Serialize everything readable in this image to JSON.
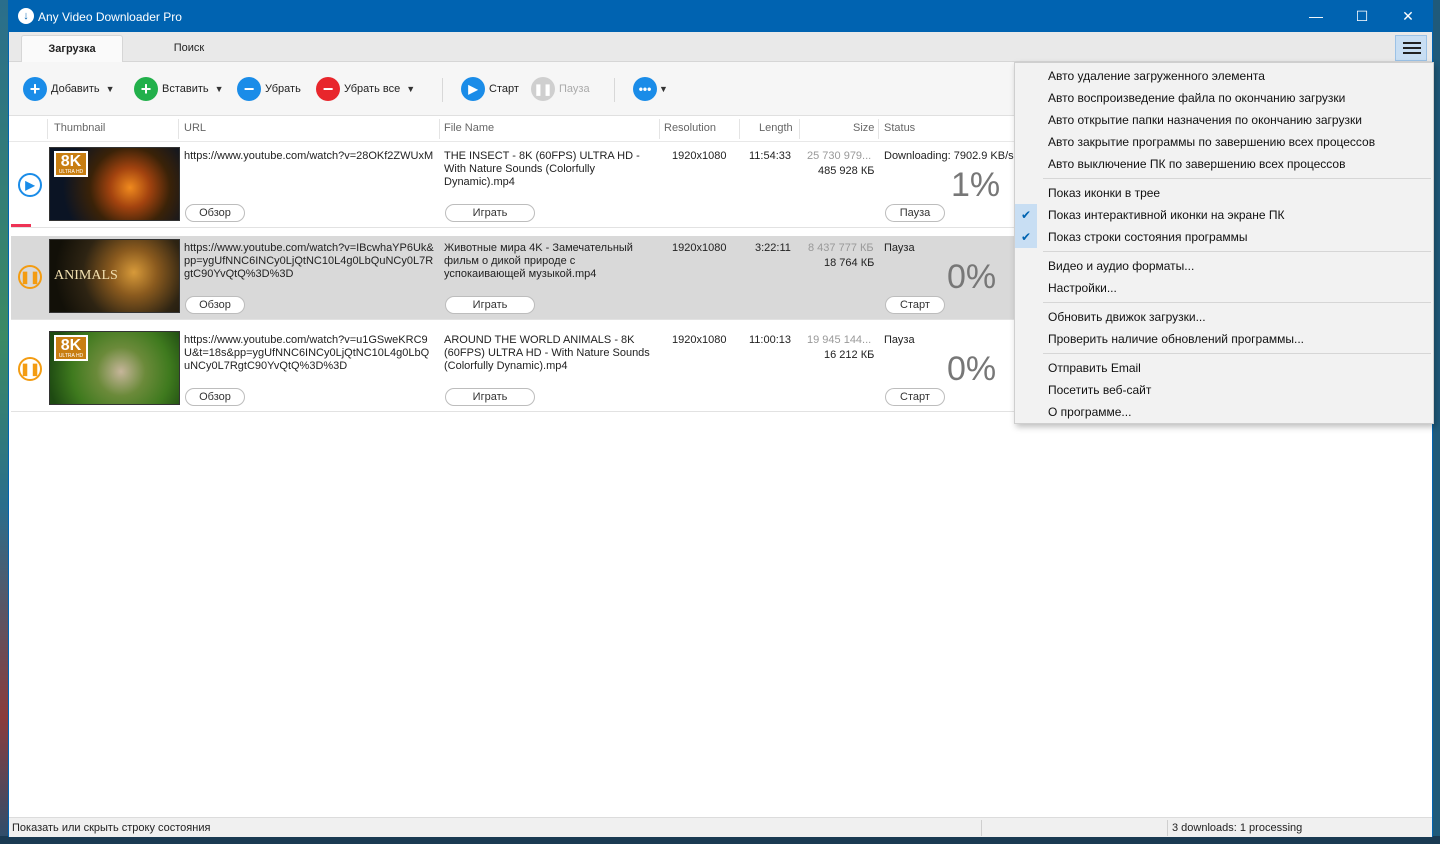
{
  "window": {
    "title": "Any Video Downloader Pro",
    "minimize": "—",
    "maximize": "☐",
    "close": "✕"
  },
  "tabs": [
    {
      "label": "Загрузка"
    },
    {
      "label": "Поиск"
    }
  ],
  "toolbar": {
    "add": "Добавить",
    "paste": "Вставить",
    "remove": "Убрать",
    "remove_all": "Убрать все",
    "start": "Старт",
    "pause": "Пауза"
  },
  "columns": {
    "thumbnail": "Thumbnail",
    "url": "URL",
    "file_name": "File Name",
    "resolution": "Resolution",
    "length": "Length",
    "size": "Size",
    "status": "Status"
  },
  "rows": [
    {
      "url": "https://www.youtube.com/watch?v=28OKf2ZWUxM",
      "file_name": "THE INSECT - 8K (60FPS) ULTRA HD - With Nature Sounds (Colorfully Dynamic).mp4",
      "resolution": "1920x1080",
      "length": "11:54:33",
      "size_total": "25 730 979...",
      "size_done": "485 928 КБ",
      "status": "Downloading: 7902.9 KB/s",
      "percent": "1%",
      "browse": "Обзор",
      "play": "Играть",
      "action": "Пауза",
      "badge": "8K",
      "badge_sub": "ULTRA HD"
    },
    {
      "url": "https://www.youtube.com/watch?v=IBcwhaYP6Uk&pp=ygUfNNC6INCy0LjQtNC10L4g0LbQuNCy0L7RgtC90YvQtQ%3D%3D",
      "file_name": "Животные мира 4K - Замечательный фильм о дикой природе с успокаивающей музыкой.mp4",
      "resolution": "1920x1080",
      "length": "3:22:11",
      "size_total": "8 437 777 КБ",
      "size_done": "18 764 КБ",
      "status": "Пауза",
      "percent": "0%",
      "browse": "Обзор",
      "play": "Играть",
      "action": "Старт",
      "wordmark": "ANIMALS"
    },
    {
      "url": "https://www.youtube.com/watch?v=u1GSweKRC9U&t=18s&pp=ygUfNNC6INCy0LjQtNC10L4g0LbQuNCy0L7RgtC90YvQtQ%3D%3D",
      "file_name": "AROUND THE WORLD ANIMALS - 8K (60FPS) ULTRA HD - With Nature Sounds (Colorfully Dynamic).mp4",
      "resolution": "1920x1080",
      "length": "11:00:13",
      "size_total": "19 945 144...",
      "size_done": "16 212 КБ",
      "status": "Пауза",
      "percent": "0%",
      "browse": "Обзор",
      "play": "Играть",
      "action": "Старт",
      "badge": "8K",
      "badge_sub": "ULTRA HD"
    }
  ],
  "menu": {
    "items": [
      {
        "label": "Авто удаление загруженного элемента",
        "checked": false
      },
      {
        "label": "Авто воспроизведение файла по окончанию загрузки",
        "checked": false
      },
      {
        "label": "Авто открытие папки назначения по окончанию загрузки",
        "checked": false
      },
      {
        "label": "Авто закрытие программы по завершению всех процессов",
        "checked": false
      },
      {
        "label": "Авто выключение ПК по завершению всех процессов",
        "checked": false
      },
      {
        "label": "Показ иконки в трее",
        "checked": false
      },
      {
        "label": "Показ интерактивной иконки на экране ПК",
        "checked": true
      },
      {
        "label": "Показ строки состояния программы",
        "checked": true
      },
      {
        "label": "Видео и аудио форматы...",
        "checked": false
      },
      {
        "label": "Настройки...",
        "checked": false
      },
      {
        "label": "Обновить движок загрузки...",
        "checked": false
      },
      {
        "label": "Проверить наличие обновлений программы...",
        "checked": false
      },
      {
        "label": "Отправить Email",
        "checked": false
      },
      {
        "label": "Посетить веб-сайт",
        "checked": false
      },
      {
        "label": "О программе...",
        "checked": false
      }
    ],
    "check_glyph": "✔"
  },
  "statusbar": {
    "left": "Показать или скрыть строку состояния",
    "right": "3 downloads: 1 processing"
  },
  "colors": {
    "accent": "#0063b1",
    "add": "#1a8ce8",
    "paste": "#22b04b",
    "remove_all": "#e8262c"
  }
}
